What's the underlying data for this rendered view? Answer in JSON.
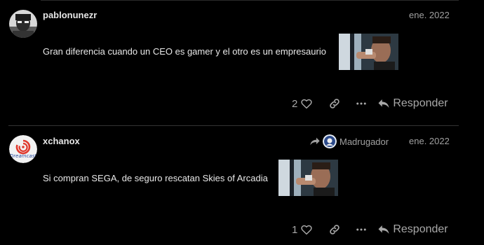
{
  "posts": [
    {
      "username": "pablonunezr",
      "date": "ene. 2022",
      "text": "Gran diferencia cuando un CEO es gamer y el otro es un empresaurio",
      "likes": "2",
      "reply_label": "Responder",
      "avatar_icon": "user-avatar-man-glasses",
      "gif_icon": "man-drinking-gif"
    },
    {
      "username": "xchanox",
      "date": "ene. 2022",
      "reply_to": "Madrugador",
      "text": "Si compran SEGA, de seguro rescatan Skies of Arcadia",
      "likes": "1",
      "reply_label": "Responder",
      "avatar_icon": "dreamcast-logo-avatar",
      "gif_icon": "man-drinking-gif"
    }
  ],
  "colors": {
    "background": "#000000",
    "text": "#e8e8e8",
    "muted": "#a0a0a0",
    "dreamcast_red": "#e03a2e"
  }
}
